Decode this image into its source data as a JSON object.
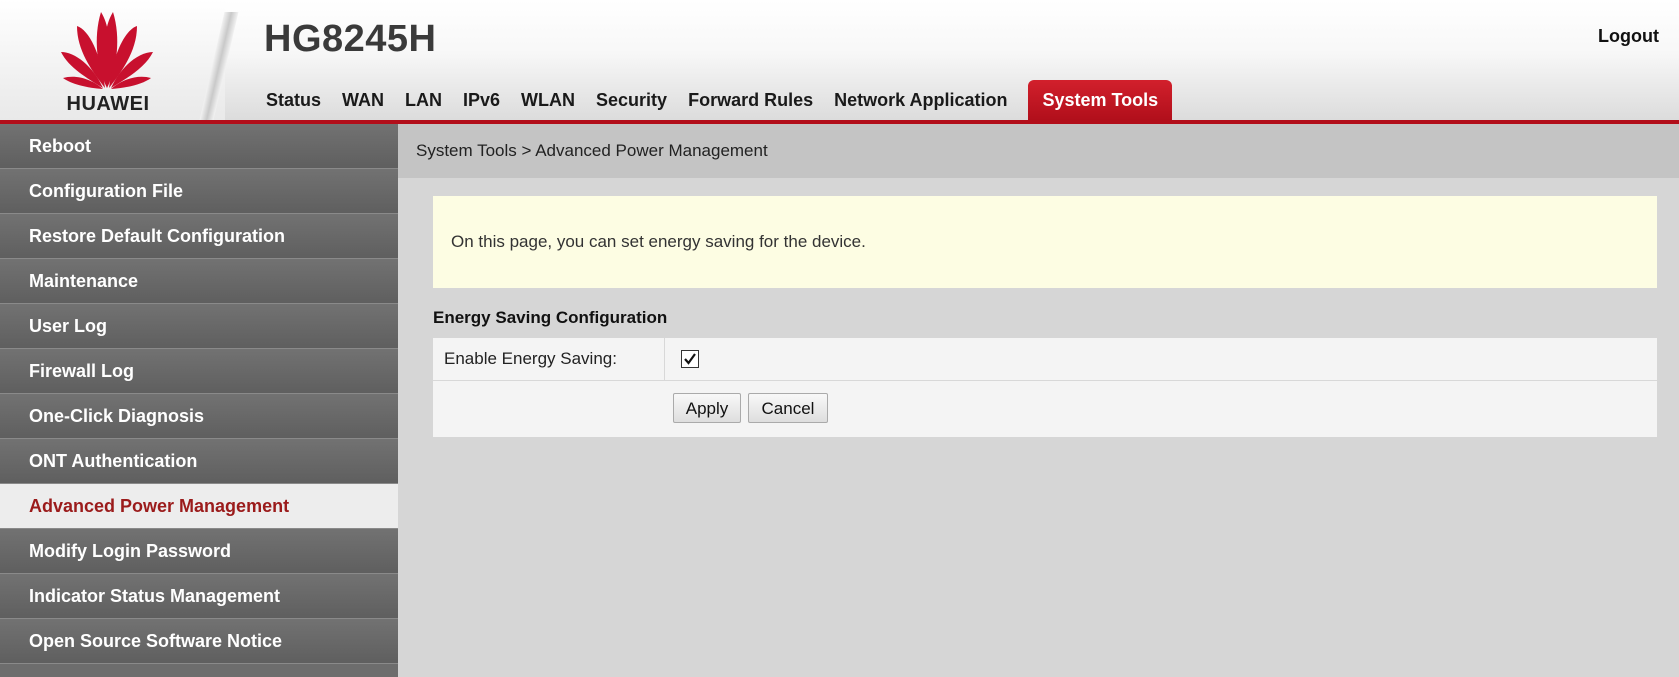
{
  "header": {
    "brand": "HUAWEI",
    "model": "HG8245H",
    "logout_label": "Logout",
    "brand_color": "#c8102e"
  },
  "topnav": {
    "items": [
      {
        "label": "Status"
      },
      {
        "label": "WAN"
      },
      {
        "label": "LAN"
      },
      {
        "label": "IPv6"
      },
      {
        "label": "WLAN"
      },
      {
        "label": "Security"
      },
      {
        "label": "Forward Rules"
      },
      {
        "label": "Network Application"
      },
      {
        "label": "System Tools",
        "active": true
      }
    ]
  },
  "sidebar": {
    "items": [
      {
        "label": "Reboot"
      },
      {
        "label": "Configuration File"
      },
      {
        "label": "Restore Default Configuration"
      },
      {
        "label": "Maintenance"
      },
      {
        "label": "User Log"
      },
      {
        "label": "Firewall Log"
      },
      {
        "label": "One-Click Diagnosis"
      },
      {
        "label": "ONT Authentication"
      },
      {
        "label": "Advanced Power Management",
        "active": true
      },
      {
        "label": "Modify Login Password"
      },
      {
        "label": "Indicator Status Management"
      },
      {
        "label": "Open Source Software Notice"
      }
    ]
  },
  "content": {
    "breadcrumb": "System Tools > Advanced Power Management",
    "notice": "On this page, you can set energy saving for the device.",
    "section_title": "Energy Saving Configuration",
    "form": {
      "enable_label": "Enable Energy Saving:",
      "enable_checked": true
    },
    "buttons": {
      "apply": "Apply",
      "cancel": "Cancel"
    }
  }
}
